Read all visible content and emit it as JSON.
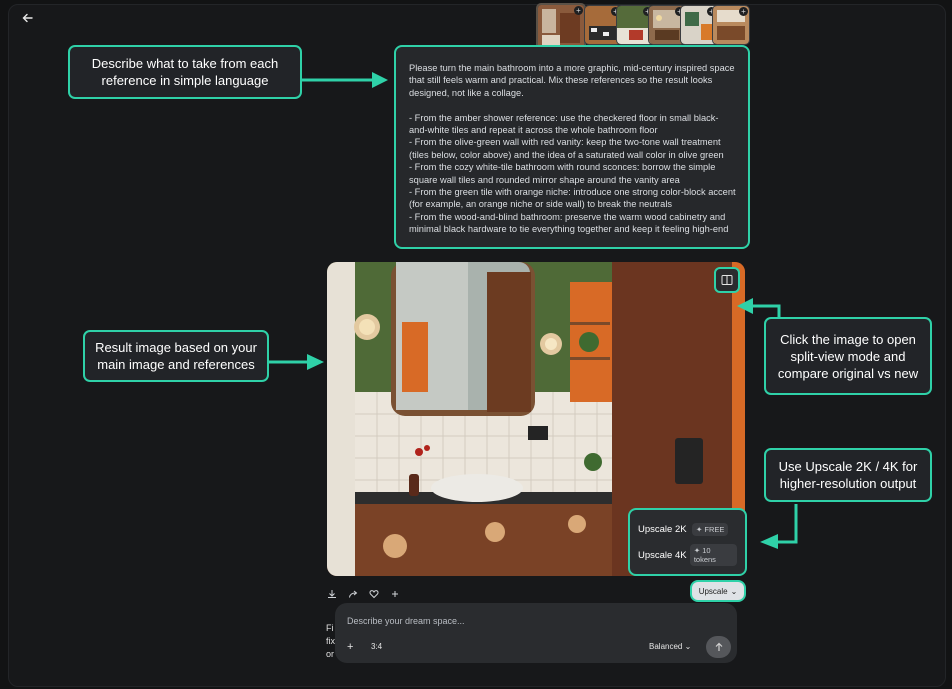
{
  "nav": {
    "back_icon": "back-arrow-icon"
  },
  "references": {
    "count": 6,
    "plus_icon": "plus-icon"
  },
  "callouts": {
    "describe": "Describe what to take from each reference in simple language",
    "result": "Result image based on your main image and references",
    "split": "Click the image to open split-view mode and compare original vs new",
    "upscale": "Use Upscale 2K / 4K for higher-resolution output"
  },
  "prompt": {
    "text": "Please turn the main bathroom into a more graphic, mid-century inspired space that still feels warm and practical. Mix these references so the result looks designed, not like a collage.\n\n- From the amber shower reference: use the checkered floor in small black-and-white tiles and repeat it across the whole bathroom floor\n- From the olive-green wall with red vanity: keep the two-tone wall treatment (tiles below, color above) and the idea of a saturated wall color in olive green\n- From the cozy white-tile bathroom with round sconces: borrow the simple square wall tiles and rounded mirror shape around the vanity area\n- From the green tile with orange niche: introduce one strong color-block accent (for example, an orange niche or side wall) to break the neutrals\n- From the wood-and-blind bathroom: preserve the warm wood cabinetry and minimal black hardware to tie everything together and keep it feeling high-end"
  },
  "result": {
    "split_icon": "split-view-icon"
  },
  "upscale_menu": {
    "items": [
      {
        "label": "Upscale 2K",
        "badge": "FREE"
      },
      {
        "label": "Upscale 4K",
        "badge": "10 tokens"
      }
    ]
  },
  "actions": {
    "icons": [
      "download-icon",
      "share-icon",
      "heart-icon",
      "plus-icon"
    ],
    "upscale_label": "Upscale"
  },
  "composer": {
    "placeholder": "Describe your dream space...",
    "ratio": "3:4",
    "mode": "Balanced",
    "send_icon": "arrow-up-icon"
  },
  "left_text": {
    "line1": "Fi",
    "line2": "fix",
    "line3": "or"
  },
  "colors": {
    "accent": "#2fd1a8",
    "background": "#17181a"
  }
}
